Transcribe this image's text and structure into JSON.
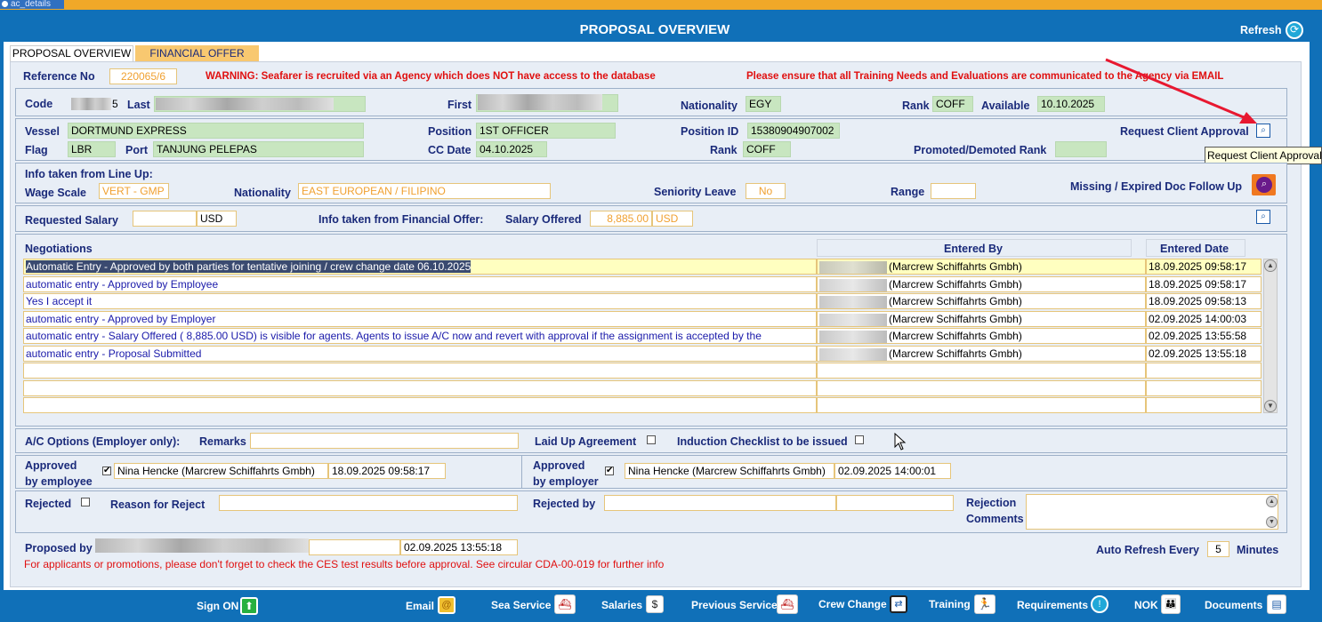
{
  "window_tab": "ac_details",
  "title": "PROPOSAL OVERVIEW",
  "refresh_label": "Refresh",
  "tabs": [
    "PROPOSAL OVERVIEW",
    "FINANCIAL OFFER"
  ],
  "reference": {
    "label": "Reference No",
    "value": "220065/6",
    "warning1": "WARNING: Seafarer is recruited via an Agency which does NOT have access to the database",
    "warning2": "Please ensure that all Training Needs and Evaluations are communicated to the Agency via EMAIL"
  },
  "seafarer": {
    "code_label": "Code",
    "code_value": "5",
    "last_label": "Last",
    "first_label": "First",
    "nationality_label": "Nationality",
    "nationality_value": "EGY",
    "rank_label": "Rank",
    "rank_value": "COFF",
    "available_label": "Available",
    "available_value": "10.10.2025"
  },
  "vessel": {
    "vessel_label": "Vessel",
    "vessel_value": "DORTMUND EXPRESS",
    "position_label": "Position",
    "position_value": "1ST OFFICER",
    "position_id_label": "Position ID",
    "position_id_value": "15380904907002",
    "request_label": "Request Client Approval",
    "flag_label": "Flag",
    "flag_value": "LBR",
    "port_label": "Port",
    "port_value": "TANJUNG PELEPAS",
    "cc_date_label": "CC Date",
    "cc_date_value": "04.10.2025",
    "rank_label": "Rank",
    "rank_value": "COFF",
    "promoted_label": "Promoted/Demoted Rank",
    "tooltip": "Request Client Approval"
  },
  "lineup": {
    "header": "Info taken from Line Up:",
    "wage_label": "Wage Scale",
    "wage_value": "VERT - GMP",
    "nationality_label": "Nationality",
    "nationality_value": "EAST EUROPEAN / FILIPINO",
    "seniority_label": "Seniority Leave",
    "seniority_value": "No",
    "range_label": "Range",
    "missing_label": "Missing / Expired Doc Follow Up"
  },
  "salary": {
    "requested_label": "Requested Salary",
    "requested_currency": "USD",
    "info_label": "Info taken from Financial Offer:",
    "offered_label": "Salary Offered",
    "offered_value": "8,885.00",
    "offered_currency": "USD"
  },
  "negotiations": {
    "label": "Negotiations",
    "entered_by_header": "Entered By",
    "entered_date_header": "Entered Date",
    "rows": [
      {
        "text": "Automatic Entry - Approved by both parties for tentative joining / crew change date 06.10.2025",
        "company": "(Marcrew Schiffahrts Gmbh)",
        "date": "18.09.2025 09:58:17"
      },
      {
        "text": "automatic entry - Approved by Employee",
        "company": "(Marcrew Schiffahrts Gmbh)",
        "date": "18.09.2025 09:58:17"
      },
      {
        "text": "Yes I accept it",
        "company": "(Marcrew Schiffahrts Gmbh)",
        "date": "18.09.2025 09:58:13"
      },
      {
        "text": "automatic entry - Approved by Employer",
        "company": "(Marcrew Schiffahrts Gmbh)",
        "date": "02.09.2025 14:00:03"
      },
      {
        "text": "automatic entry - Salary Offered (    8,885.00 USD) is visible for agents. Agents to issue A/C now and revert with approval if the assignment is accepted by the",
        "company": "(Marcrew Schiffahrts Gmbh)",
        "date": "02.09.2025 13:55:58"
      },
      {
        "text": "automatic entry - Proposal Submitted",
        "company": "(Marcrew Schiffahrts Gmbh)",
        "date": "02.09.2025 13:55:18"
      }
    ]
  },
  "options": {
    "ac_label": "A/C Options (Employer only):",
    "remarks_label": "Remarks",
    "laid_up_label": "Laid Up Agreement",
    "induction_label": "Induction Checklist to be issued"
  },
  "approval": {
    "employee_label1": "Approved",
    "employee_label2": "by employee",
    "employee_name": "Nina Hencke (Marcrew Schiffahrts Gmbh)",
    "employee_date": "18.09.2025 09:58:17",
    "employer_label1": "Approved",
    "employer_label2": "by employer",
    "employer_name": "Nina Hencke (Marcrew Schiffahrts Gmbh)",
    "employer_date": "02.09.2025 14:00:01",
    "check": "✔"
  },
  "reject": {
    "rejected_label": "Rejected",
    "reason_label": "Reason for Reject",
    "rejected_by_label": "Rejected by",
    "comments_label1": "Rejection",
    "comments_label2": "Comments"
  },
  "proposed": {
    "label": "Proposed by",
    "date": "02.09.2025 13:55:18",
    "note": "For applicants or promotions, please don't forget to check the CES test results before approval.  See circular CDA-00-019 for further info",
    "auto_refresh_label": "Auto Refresh Every",
    "auto_refresh_value": "5",
    "minutes_label": "Minutes"
  },
  "footer": [
    "Sign ON",
    "Email",
    "Sea Service",
    "Salaries",
    "Previous Service",
    "Crew Change",
    "Training",
    "Requirements",
    "NOK",
    "Documents"
  ]
}
